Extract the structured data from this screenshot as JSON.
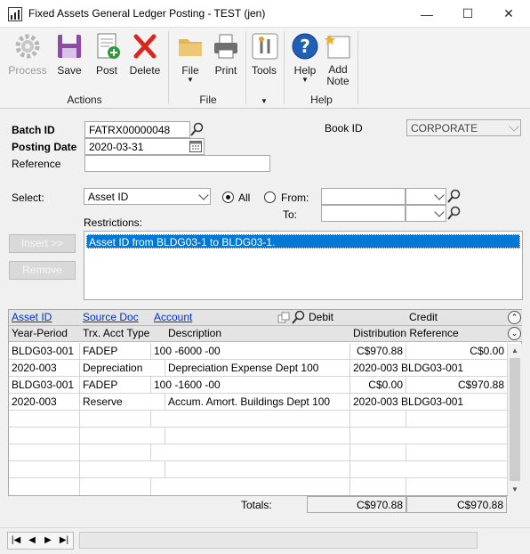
{
  "window": {
    "title": "Fixed Assets General Ledger Posting  -  TEST (jen)",
    "minimize": "—",
    "maximize": "☐",
    "close": "✕"
  },
  "ribbon": {
    "actions": {
      "process": "Process",
      "save": "Save",
      "post": "Post",
      "delete": "Delete",
      "group": "Actions"
    },
    "file": {
      "file": "File",
      "print": "Print",
      "group": "File"
    },
    "tools": {
      "tools": "Tools"
    },
    "help": {
      "help": "Help",
      "add_note_1": "Add",
      "add_note_2": "Note",
      "group": "Help"
    }
  },
  "form": {
    "batch_id_label": "Batch ID",
    "batch_id_value": "FATRX00000048",
    "posting_date_label": "Posting Date",
    "posting_date_value": "2020-03-31",
    "reference_label": "Reference",
    "reference_value": "",
    "book_id_label": "Book ID",
    "book_id_value": "CORPORATE",
    "select_label": "Select:",
    "select_value": "Asset ID",
    "all_label": "All",
    "from_label": "From:",
    "to_label": "To:",
    "restrictions_label": "Restrictions:",
    "restriction_item": "Asset ID from BLDG03-1 to BLDG03-1.",
    "insert_button": "Insert >>",
    "remove_button": "Remove"
  },
  "grid": {
    "header1": [
      "Asset ID",
      "Source Doc",
      "Account",
      "Debit",
      "Credit"
    ],
    "header2": [
      "Year-Period",
      "Trx. Acct Type",
      "Description",
      "Distribution Reference"
    ],
    "rows": [
      [
        "BLDG03-001",
        "FADEP",
        "100 -6000 -00",
        "C$970.88",
        "C$0.00"
      ],
      [
        "2020-003",
        "Depreciation",
        "Depreciation Expense Dept 100",
        "2020-003 BLDG03-001",
        ""
      ],
      [
        "BLDG03-001",
        "FADEP",
        "100 -1600 -00",
        "C$0.00",
        "C$970.88"
      ],
      [
        "2020-003",
        "Reserve",
        "Accum. Amort. Buildings Dept 100",
        "2020-003 BLDG03-001",
        ""
      ]
    ],
    "totals_label": "Totals:",
    "total_debit": "C$970.88",
    "total_credit": "C$970.88"
  },
  "colors": {
    "selection": "#0078d7",
    "link": "#0033cc",
    "delete_red": "#d9281b",
    "help_blue": "#1f5fb5"
  },
  "icons": [
    "app-icon",
    "gear-icon",
    "save-icon",
    "post-icon",
    "delete-icon",
    "folder-icon",
    "printer-icon",
    "tools-icon",
    "help-icon",
    "add-note-icon",
    "lookup-icon",
    "calendar-icon"
  ]
}
